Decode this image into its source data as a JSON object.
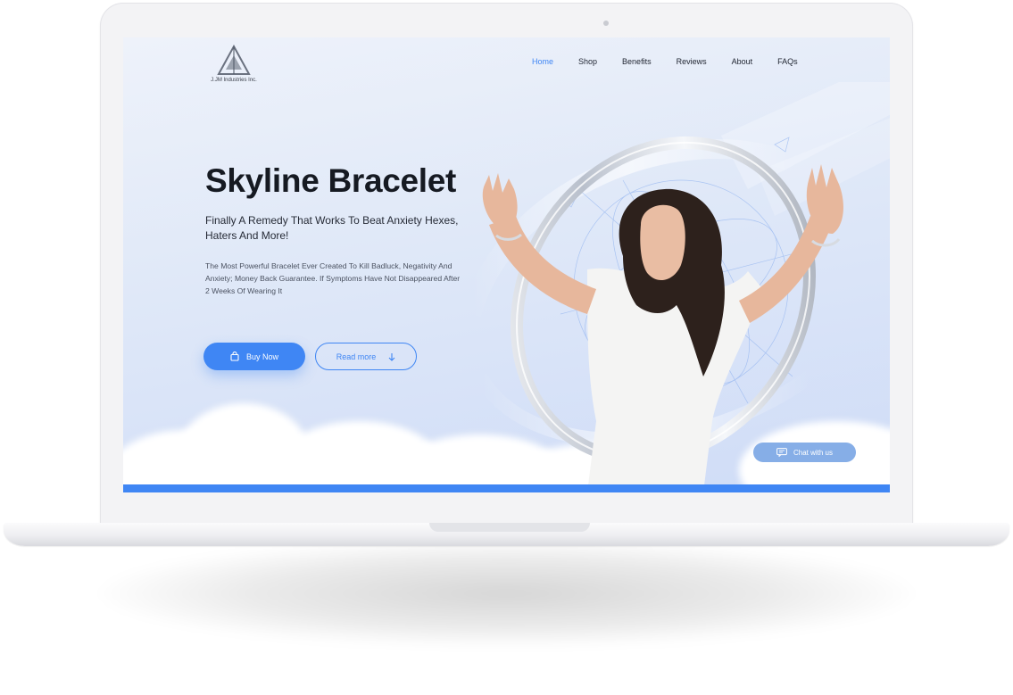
{
  "brand": {
    "company": "J.JM Industries Inc."
  },
  "nav": {
    "items": [
      {
        "label": "Home",
        "active": true
      },
      {
        "label": "Shop",
        "active": false
      },
      {
        "label": "Benefits",
        "active": false
      },
      {
        "label": "Reviews",
        "active": false
      },
      {
        "label": "About",
        "active": false
      },
      {
        "label": "FAQs",
        "active": false
      }
    ]
  },
  "hero": {
    "title": "Skyline Bracelet",
    "subtitle": "Finally A Remedy That Works To Beat Anxiety Hexes, Haters And More!",
    "description": "The Most Powerful Bracelet Ever Created To Kill Badluck, Negativity And Anxiety; Money Back Guarantee. If Symptoms Have Not Disappeared After 2 Weeks Of Wearing It",
    "buy_label": "Buy Now",
    "read_label": "Read more"
  },
  "chat": {
    "label": "Chat with us"
  },
  "icons": {
    "buy": "shopping-bag-icon",
    "read": "arrow-down-icon",
    "chat": "chat-bubble-icon"
  },
  "colors": {
    "accent": "#3f86f4",
    "chat": "#86aee7",
    "title": "#161a22"
  }
}
